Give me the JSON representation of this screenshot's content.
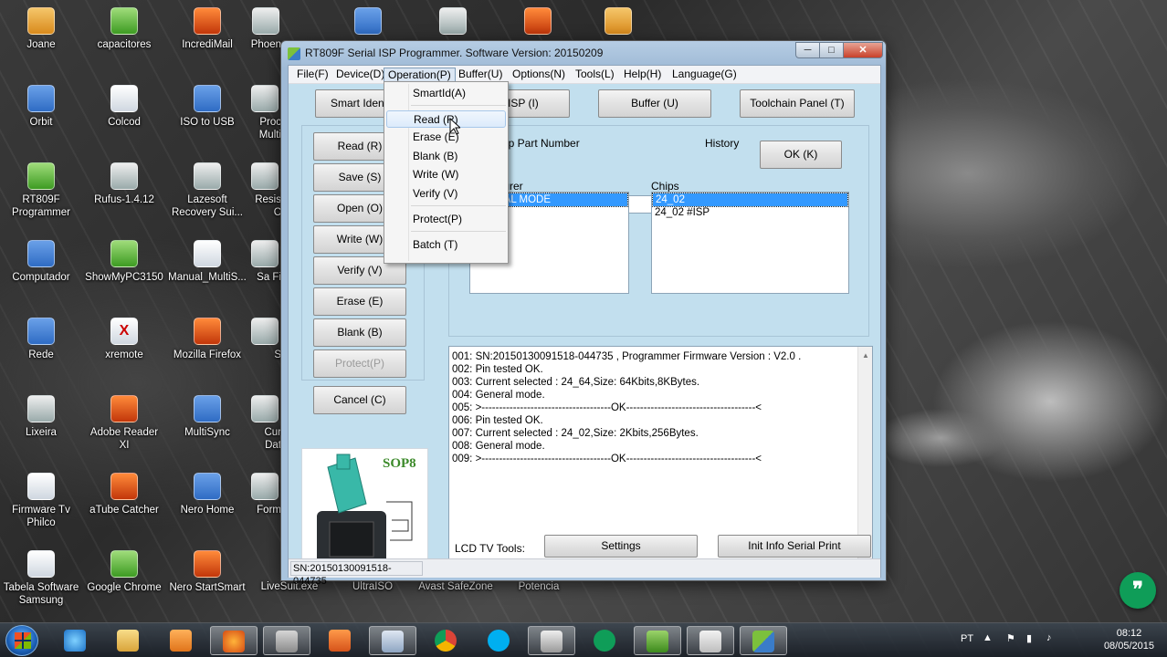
{
  "desktop": {
    "icons": [
      {
        "label": "Joane",
        "glyph": "folder-icon"
      },
      {
        "label": "capacitores",
        "glyph": "chart-icon"
      },
      {
        "label": "IncrediMail",
        "glyph": "mail-icon"
      },
      {
        "label": "Phoen",
        "glyph": "program-icon"
      },
      {
        "label": "Orbit",
        "glyph": "orbit-icon"
      },
      {
        "label": "Colcod",
        "glyph": "resistor-icon"
      },
      {
        "label": "ISO to USB",
        "glyph": "usb-icon"
      },
      {
        "label": "Proc Multi",
        "glyph": "program-icon"
      },
      {
        "label": "RT809F Programmer",
        "glyph": "programmer-icon"
      },
      {
        "label": "Rufus-1.4.12",
        "glyph": "usb-icon"
      },
      {
        "label": "Lazesoft Recovery Sui...",
        "glyph": "disc-icon"
      },
      {
        "label": "Resis C",
        "glyph": "program-icon"
      },
      {
        "label": "Computador",
        "glyph": "computer-icon"
      },
      {
        "label": "ShowMyPC3150",
        "glyph": "remote-icon"
      },
      {
        "label": "Manual_MultiS...",
        "glyph": "document-icon"
      },
      {
        "label": "Sa Fi",
        "glyph": "program-icon"
      },
      {
        "label": "Rede",
        "glyph": "network-icon"
      },
      {
        "label": "xremote",
        "glyph": "xremote-icon"
      },
      {
        "label": "Mozilla Firefox",
        "glyph": "firefox-icon"
      },
      {
        "label": "S",
        "glyph": "program-icon"
      },
      {
        "label": "Lixeira",
        "glyph": "recycle-bin-icon"
      },
      {
        "label": "Adobe Reader XI",
        "glyph": "pdf-icon"
      },
      {
        "label": "MultiSync",
        "glyph": "program-icon"
      },
      {
        "label": "Cur Dat",
        "glyph": "program-icon"
      },
      {
        "label": "Firmware Tv Philco",
        "glyph": "document-icon"
      },
      {
        "label": "aTube Catcher",
        "glyph": "download-icon"
      },
      {
        "label": "Nero Home",
        "glyph": "nero-icon"
      },
      {
        "label": "Form",
        "glyph": "program-icon"
      },
      {
        "label": "Tabela Software Samsung",
        "glyph": "document-icon"
      },
      {
        "label": "Google Chrome",
        "glyph": "chrome-icon"
      },
      {
        "label": "Nero StartSmart",
        "glyph": "nero-icon"
      },
      {
        "label": "LiveSuit.exe",
        "glyph": "program-icon"
      },
      {
        "label": "UltraISO",
        "glyph": "program-icon"
      },
      {
        "label": "Avast SafeZone",
        "glyph": "program-icon"
      },
      {
        "label": "Potencia",
        "glyph": "program-icon"
      }
    ]
  },
  "window": {
    "title": "RT809F Serial ISP Programmer. Software Version: 20150209",
    "controls": {
      "minimize": "─",
      "maximize": "□",
      "close": "✕"
    },
    "menu": [
      "File(F)",
      "Device(D)",
      "Operation(P)",
      "Buffer(U)",
      "Options(N)",
      "Tools(L)",
      "Help(H)",
      "Language(G)"
    ],
    "top_buttons": {
      "smart_ident": "Smart Identi",
      "isp": "ISP (I)",
      "buffer": "Buffer (U)",
      "toolchain": "Toolchain Panel (T)"
    },
    "side_buttons": [
      "Read (R)",
      "Save (S)",
      "Open (O)",
      "Write  (W)",
      "Verify (V)",
      "Erase (E)",
      "Blank (B)",
      "Protect(P)"
    ],
    "cancel": "Cancel (C)",
    "chip_part_label": "ip Part Number",
    "history_label": "History",
    "ok_button": "OK (K)",
    "manufacturer_label": "cturer",
    "manufacturer_items": [
      "EAL MODE"
    ],
    "chips_label": "Chips",
    "chip_items": [
      "24_02",
      "24_02 #ISP"
    ],
    "chip_image_label": "SOP8",
    "log_lines": [
      "001:  SN:20150130091518-044735 , Programmer Firmware Version : V2.0 .",
      "002:  Pin tested OK.",
      "003:  Current selected : 24_64,Size: 64Kbits,8KBytes.",
      "004:  General mode.",
      "005:  >-------------------------------------OK-------------------------------------<",
      "006:  Pin tested OK.",
      "007:  Current selected : 24_02,Size: 2Kbits,256Bytes.",
      "008:  General mode.",
      "009:  >-------------------------------------OK-------------------------------------<"
    ],
    "lcd_tools_label": "LCD TV Tools:",
    "settings_button": "Settings",
    "init_info_button": "Init Info Serial Print",
    "status": "SN:20150130091518-044735"
  },
  "operation_menu": {
    "items": [
      {
        "label": "SmartId(A)"
      },
      {
        "label": "Read   (R)",
        "highlighted": true
      },
      {
        "label": "Erase  (E)"
      },
      {
        "label": "Blank  (B)"
      },
      {
        "label": "Write  (W)"
      },
      {
        "label": "Verify (V)"
      },
      {
        "label": "Protect(P)"
      },
      {
        "label": "Batch  (T)"
      }
    ]
  },
  "taskbar": {
    "apps": [
      "internet-explorer-icon",
      "file-explorer-icon",
      "media-player-icon",
      "firefox-icon",
      "tools-icon",
      "mail-icon",
      "device-manager-icon",
      "chrome-icon",
      "skype-icon",
      "capture-icon",
      "hangouts-icon",
      "camtasia-icon",
      "camtasia-recorder-icon",
      "rt809f-icon"
    ],
    "language": "PT",
    "time": "08:12",
    "date": "08/05/2015"
  },
  "colors": {
    "selection": "#3399ff",
    "window_frame": "#a9c4de",
    "panel": "#c2dfee",
    "hangouts": "#0f9d58"
  }
}
